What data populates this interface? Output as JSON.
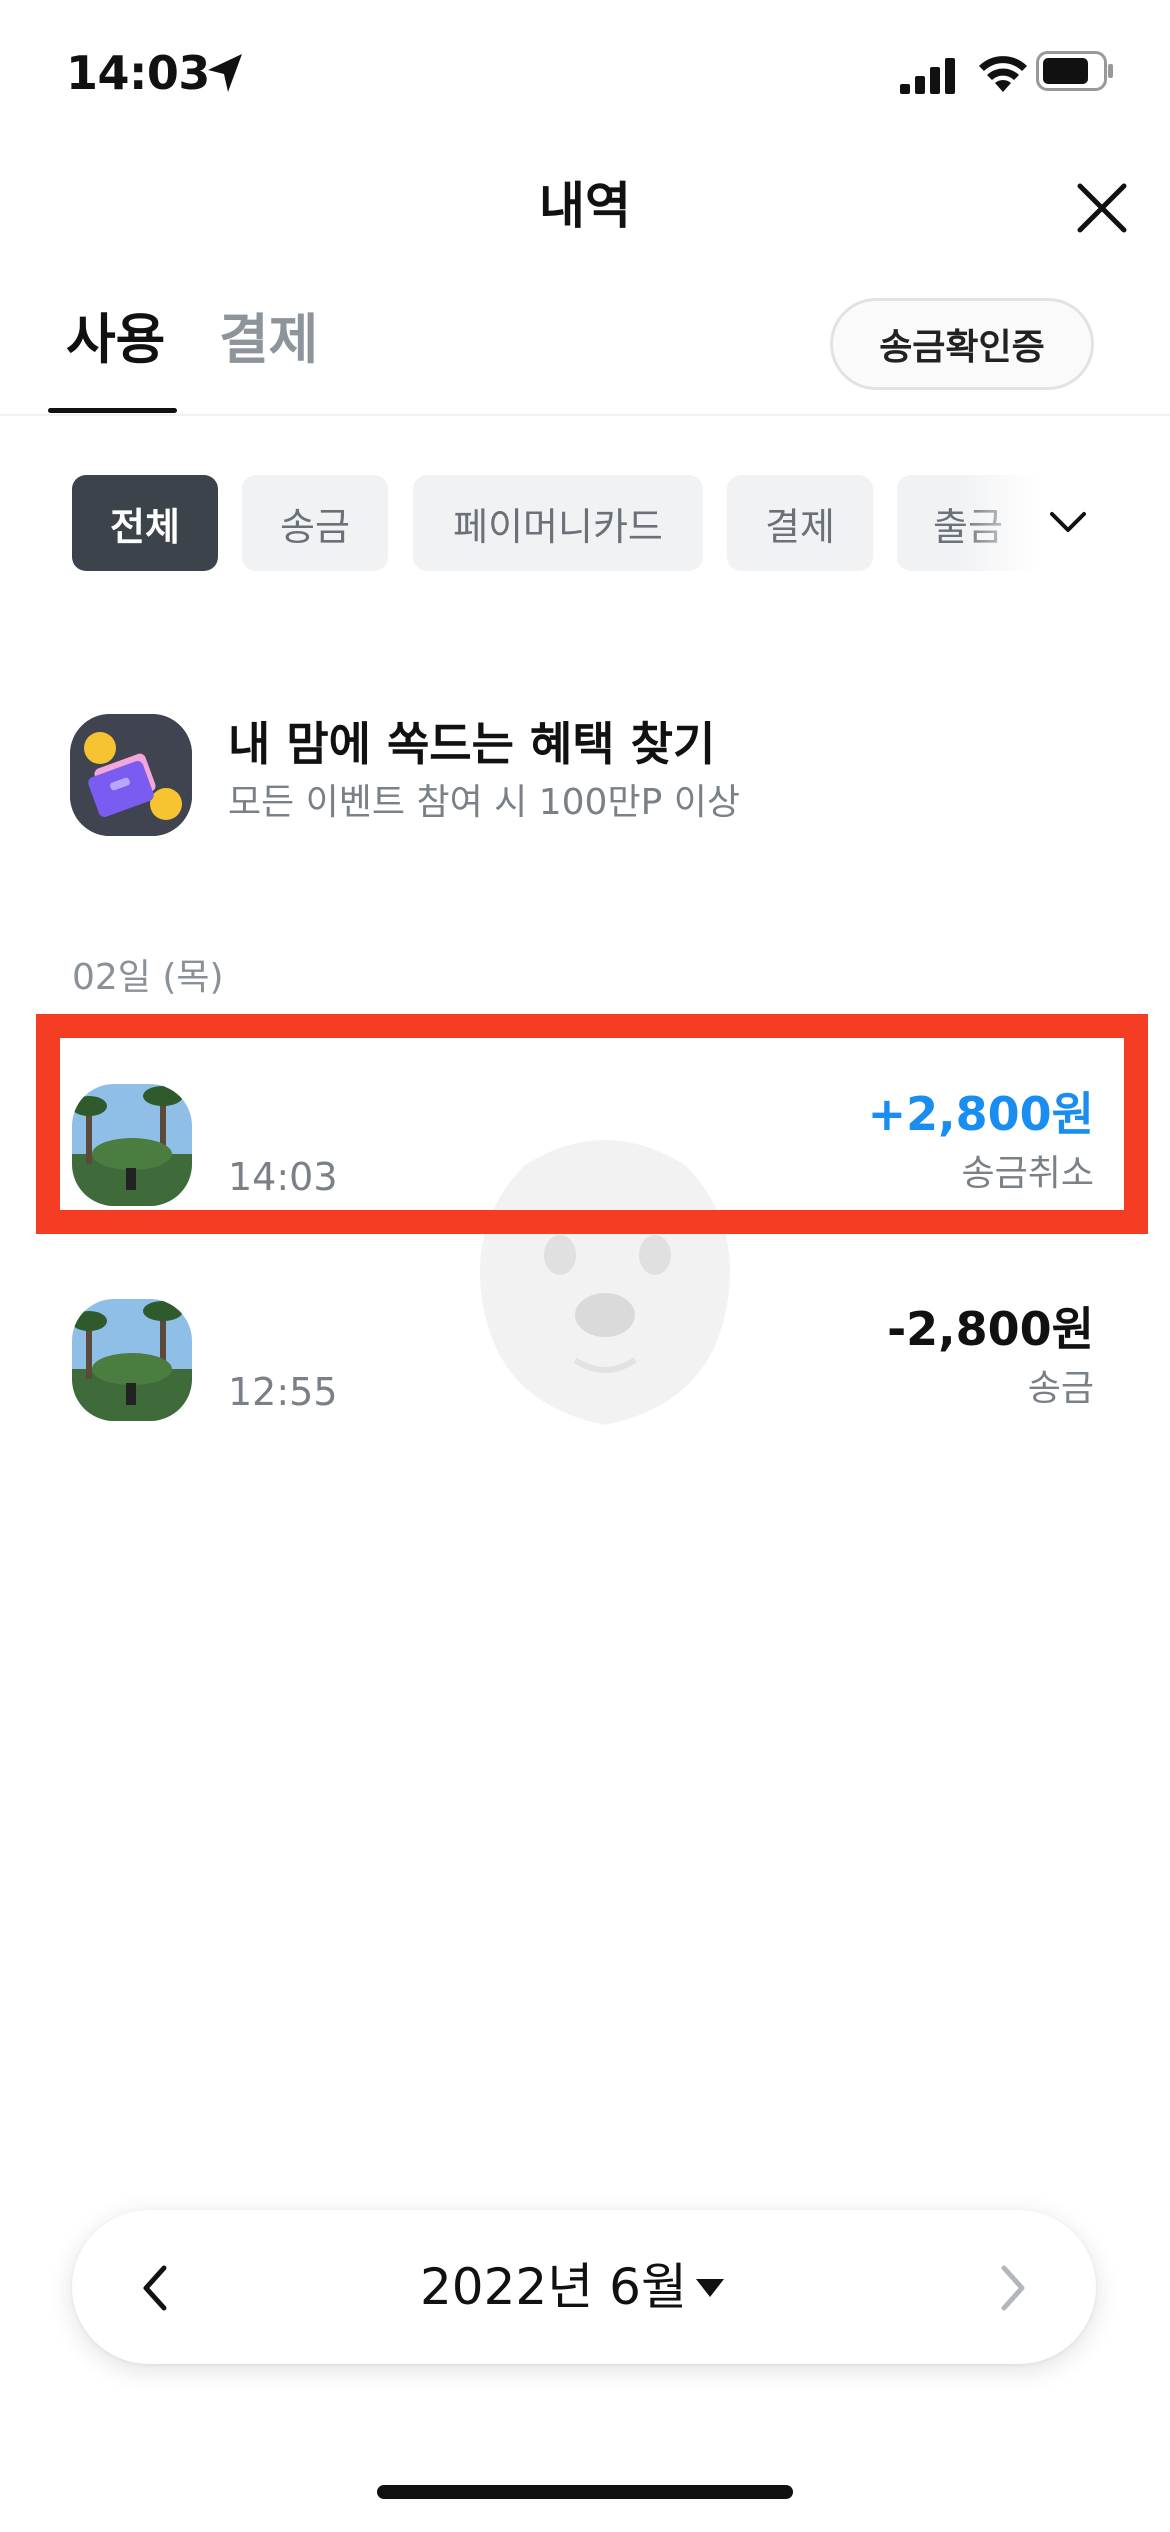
{
  "status_bar": {
    "time": "14:03",
    "icons": [
      "location-arrow-icon",
      "cellular-signal-icon",
      "wifi-icon",
      "battery-icon"
    ]
  },
  "header": {
    "title": "내역",
    "close_icon": "close-icon"
  },
  "tabs": [
    {
      "label": "사용",
      "active": true
    },
    {
      "label": "결제",
      "active": false
    }
  ],
  "certificate_button": "송금확인증",
  "filter_chips": [
    {
      "label": "전체",
      "active": true
    },
    {
      "label": "송금",
      "active": false
    },
    {
      "label": "페이머니카드",
      "active": false
    },
    {
      "label": "결제",
      "active": false
    },
    {
      "label": "출금",
      "active": false
    }
  ],
  "promo": {
    "title": "내 맘에 쏙드는 혜택 찾기",
    "subtitle": "모든 이벤트 참여 시 100만P 이상"
  },
  "date_header": "02일 (목)",
  "transactions": [
    {
      "time": "14:03",
      "amount": "+2,800원",
      "type": "송금취소",
      "highlighted": true
    },
    {
      "time": "12:55",
      "amount": "-2,800원",
      "type": "송금",
      "highlighted": false
    }
  ],
  "month_selector": {
    "label": "2022년 6월"
  },
  "colors": {
    "accent_blue": "#1a8df0",
    "highlight_red": "#f43d22",
    "chip_active": "#3d434b"
  }
}
